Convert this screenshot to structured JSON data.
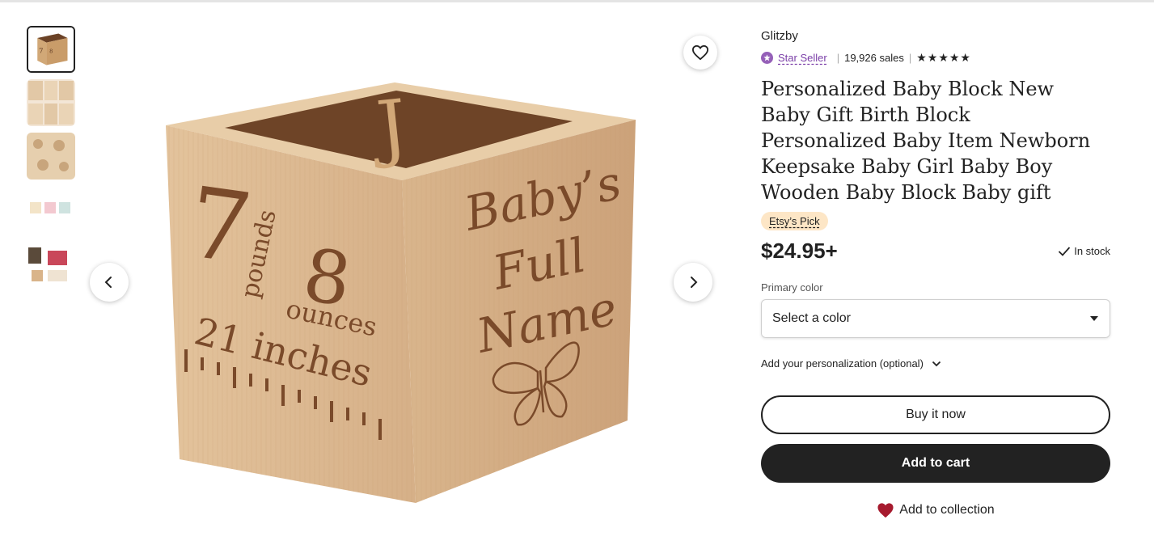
{
  "listing": {
    "shop_name": "Glitzby",
    "star_seller_label": "Star Seller",
    "sales": "19,926 sales",
    "rating_stars": "★★★★★",
    "title": "Personalized Baby Block New Baby Gift Birth Block Personalized Baby Item Newborn Keepsake Baby Girl Baby Boy Wooden Baby Block Baby gift",
    "badge": "Etsy’s Pick",
    "price": "$24.95+",
    "stock": "In stock",
    "primary_color_label": "Primary color",
    "select_placeholder": "Select a color",
    "personalization_label": "Add your personalization (optional)",
    "buy_now": "Buy it now",
    "add_to_cart": "Add to cart",
    "add_to_collection": "Add to collection"
  },
  "block_image": {
    "top_letter": "J",
    "weight_pounds": "7",
    "pounds_label": "pounds",
    "weight_ounces": "8",
    "ounces_label": "ounces",
    "length": "21 inches",
    "name_line1": "Baby’s",
    "name_line2": "Full",
    "name_line3": "Name"
  },
  "icons": {
    "favorite": "heart-outline-icon",
    "prev": "chevron-left-icon",
    "next": "chevron-right-icon",
    "star_seller": "star-seller-badge-icon",
    "stock": "checkmark-icon",
    "dropdown": "caret-down-icon",
    "personalization": "chevron-down-icon",
    "collection": "heart-filled-icon"
  },
  "colors": {
    "accent_purple": "#7b3fa8",
    "badge_bg": "#fde6c6",
    "dark": "#222222",
    "heart_red": "#a61a2e",
    "wood_light": "#d9b48a",
    "wood_dark": "#6b4226"
  }
}
